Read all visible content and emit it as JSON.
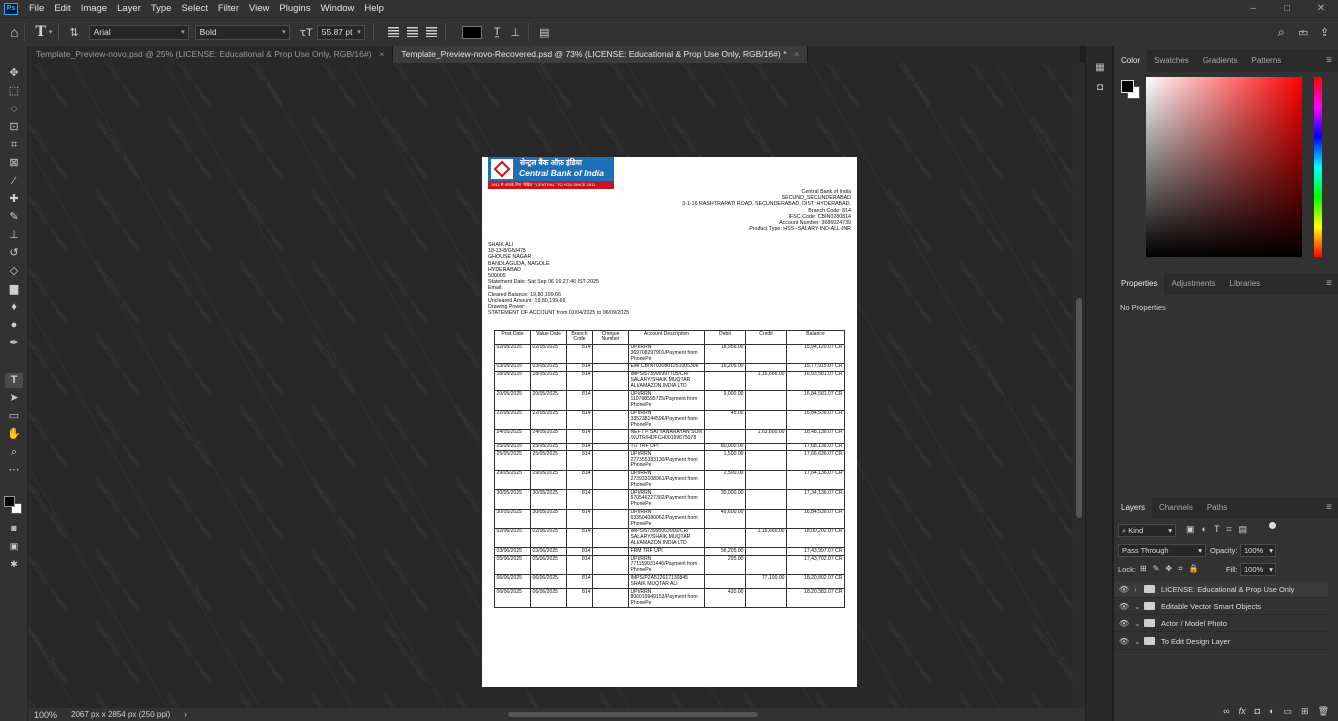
{
  "menu": [
    "File",
    "Edit",
    "Image",
    "Layer",
    "Type",
    "Select",
    "Filter",
    "View",
    "Plugins",
    "Window",
    "Help"
  ],
  "app_logo": "Ps",
  "window_controls": [
    "–",
    "□",
    "✕"
  ],
  "options_bar": {
    "font_family": "Arial",
    "font_style": "Bold",
    "font_size": "55.87 pt"
  },
  "tabs": [
    {
      "label": "Template_Preview-novo.psd @ 25% (LICENSE: Educational & Prop Use Only, RGB/16#)",
      "close": "×"
    },
    {
      "label": "Template_Preview-novo-Recovered.psd @ 73% (LICENSE: Educational & Prop Use Only, RGB/16#) *",
      "close": "×"
    }
  ],
  "status": {
    "zoom": "100%",
    "doc_info": "2067 px x 2854 px (250 ppi)",
    "arrow": "›"
  },
  "color_panel_tabs": [
    "Color",
    "Swatches",
    "Gradients",
    "Patterns"
  ],
  "properties_panel": {
    "tabs": [
      "Properties",
      "Adjustments",
      "Libraries"
    ],
    "empty_text": "No Properties"
  },
  "layers_panel": {
    "tabs": [
      "Layers",
      "Channels",
      "Paths"
    ],
    "filter_kind": "Kind",
    "blend_mode": "Pass Through",
    "opacity_label": "Opacity:",
    "opacity": "100%",
    "lock_label": "Lock:",
    "fill_label": "Fill:",
    "fill": "100%",
    "layers": [
      "LICENSE: Educational & Prop Use Only",
      "Editable Vector Smart Objects",
      "Actor / Model Photo",
      "To Edit Design Layer"
    ]
  },
  "watermark_text": "Digital Design Template",
  "document": {
    "logo": {
      "hindi": "सेन्ट्रल बैंक ऑफ़ इंडिया",
      "english": "Central Bank of India",
      "band": "1911 से आपके लिए \"केंद्रित\" \"CENTRAL\" TO YOU SINCE 1911"
    },
    "branch": [
      "Central Bank of India",
      "SECUND_SECUNDERABAD",
      "3-1-16 RASHTRAPATI ROAD, SECUNDERABAD, DIST: HYDERABAD.",
      "Branch Code: 814",
      "IFSC Code: CBIN0280814",
      "Account Number: 3686024739",
      "Product Type: HSS--SALARY-IND-ALL-INR"
    ],
    "customer": [
      "SHAIK ALI",
      "18-13-8/GN/475",
      "GHOUSE NAGAR",
      "BANDLAGUDA, NAGOLE",
      "HYDERABAD",
      "500005",
      "Statement Date :Sat Sep 06 16:27:46 IST 2025",
      "Email:",
      "Cleared Balance: 19,80,199.66",
      "Uncleared Amount: 19,80,199.66",
      "Drawing Power:",
      "STATEMENT OF ACCOUNT from 01/04/2025 to 06/09/2025"
    ],
    "table": {
      "headers": [
        "Post Date",
        "Value Date",
        "Branch Code",
        "Cheque Number",
        "Account Description",
        "Debit",
        "Credit",
        "Balance"
      ],
      "rows": [
        [
          "02/05/2025",
          "02/05/2025",
          "814",
          "",
          "UPI/RRN 369708297901/Payment from PhonePe",
          "18,956.00",
          "",
          "15,94,120.07 CR"
        ],
        [
          "03/05/2025",
          "03/05/2025",
          "814",
          "",
          "EMI CBIN7030801251005306",
          "16,205.00",
          "",
          "15,77,915.07 CR"
        ],
        [
          "18/05/2025",
          "18/05/2025",
          "814",
          "",
          "IMPS/673995997705/CR/ SALARY/SHAIK MUQTAR ALI/AMAZON INDIA LTD",
          "",
          "1,15,666.00",
          "16,93,581.07 CR"
        ],
        [
          "20/05/2025",
          "20/05/2025",
          "814",
          "",
          "UPI/RRN 110798595725/Payment from PhonePe",
          "9,000.00",
          "",
          "16,84,581.07 CR"
        ],
        [
          "22/05/2025",
          "22/05/2025",
          "814",
          "",
          "UPI/RRN 335238144596/Payment from PhonePe",
          "45.00",
          "",
          "16,84,536.07 CR"
        ],
        [
          "24/05/2025",
          "24/05/2025",
          "814",
          "",
          "NEFT P SATYANARAYAN SON /XUTR/HDFCH00199675078",
          "",
          "1,63,600.00",
          "18,48,136.07 CR"
        ],
        [
          "25/05/2025",
          "25/05/2025",
          "814",
          "",
          "TO TRF UPI",
          "80,000.00",
          "",
          "17,68,136.07 CR"
        ],
        [
          "25/05/2025",
          "25/05/2025",
          "814",
          "",
          "UPI/RRN 277355383130/Payment from PhonePe",
          "1,500.00",
          "",
          "17,66,636.07 CR"
        ],
        [
          "29/05/2025",
          "29/05/2025",
          "814",
          "",
          "UPI/RRN 273933108961/Payment from PhonePe",
          "2,500.00",
          "",
          "17,64,136.07 CR"
        ],
        [
          "30/05/2025",
          "30/05/2025",
          "814",
          "",
          "UPI/RRN 670546227362/Payment from PhonePe",
          "30,000.00",
          "",
          "17,34,136.07 CR"
        ],
        [
          "30/05/2025",
          "30/05/2025",
          "814",
          "",
          "UPI/RRN 633504080062/Payment from PhonePe",
          "49,600.00",
          "",
          "16,84,536.07 CR"
        ],
        [
          "02/06/2025",
          "02/06/2025",
          "814",
          "",
          "IMPS/673995063900/CR/ SALARY/SHAIK MUQTAR ALI/AMAZON INDIA LTD",
          "",
          "1,15,666.00",
          "18,00,202.07 CR"
        ],
        [
          "03/06/2025",
          "03/06/2025",
          "814",
          "",
          "FRM TRF UPI",
          "56,205.00",
          "",
          "17,43,997.07 CR"
        ],
        [
          "05/06/2025",
          "05/06/2025",
          "814",
          "",
          "UPI/RRN 771159031446/Payment from PhonePe",
          "295.00",
          "",
          "17,43,702.07 CR"
        ],
        [
          "06/06/2025",
          "06/06/2025",
          "814",
          "",
          "IMPS/P2A512617130845 SHAIK MUQTAR ALI",
          "",
          "77,100.00",
          "18,20,802.07 CR"
        ],
        [
          "06/06/2025",
          "06/06/2025",
          "814",
          "",
          "UPI/RRN 806019949153/Payment from PhonePe",
          "420.00",
          "",
          "18,20,382.07 CR"
        ]
      ]
    }
  }
}
